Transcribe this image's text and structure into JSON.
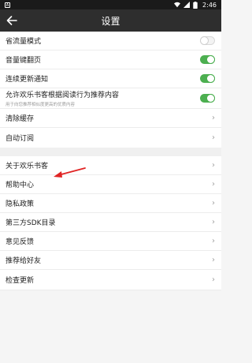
{
  "status_bar": {
    "app_badge": "A",
    "time": "2:46"
  },
  "header": {
    "title": "设置"
  },
  "toggles": [
    {
      "label": "省流量模式",
      "on": false
    },
    {
      "label": "音量键翻页",
      "on": true
    },
    {
      "label": "连续更新通知",
      "on": true
    },
    {
      "label": "允许欢乐书客根据阅读行为推荐内容",
      "sub": "用于向您推荐相似度更高的优质内容",
      "on": true
    }
  ],
  "group1_links": [
    {
      "label": "清除缓存"
    },
    {
      "label": "自动订阅"
    }
  ],
  "group2_links": [
    {
      "label": "关于欢乐书客"
    },
    {
      "label": "帮助中心"
    },
    {
      "label": "隐私政策"
    },
    {
      "label": "第三方SDK目录"
    },
    {
      "label": "意见反馈"
    },
    {
      "label": "推荐给好友"
    },
    {
      "label": "检查更新"
    }
  ],
  "chevron": "›",
  "colors": {
    "app_bar": "#2e2e2e",
    "toggle_on": "#4caf50",
    "annotation_arrow": "#e02424"
  },
  "icons": {
    "back": "arrow-left-icon",
    "chevron": "chevron-right-icon",
    "annotation": "red-arrow-annotation"
  }
}
